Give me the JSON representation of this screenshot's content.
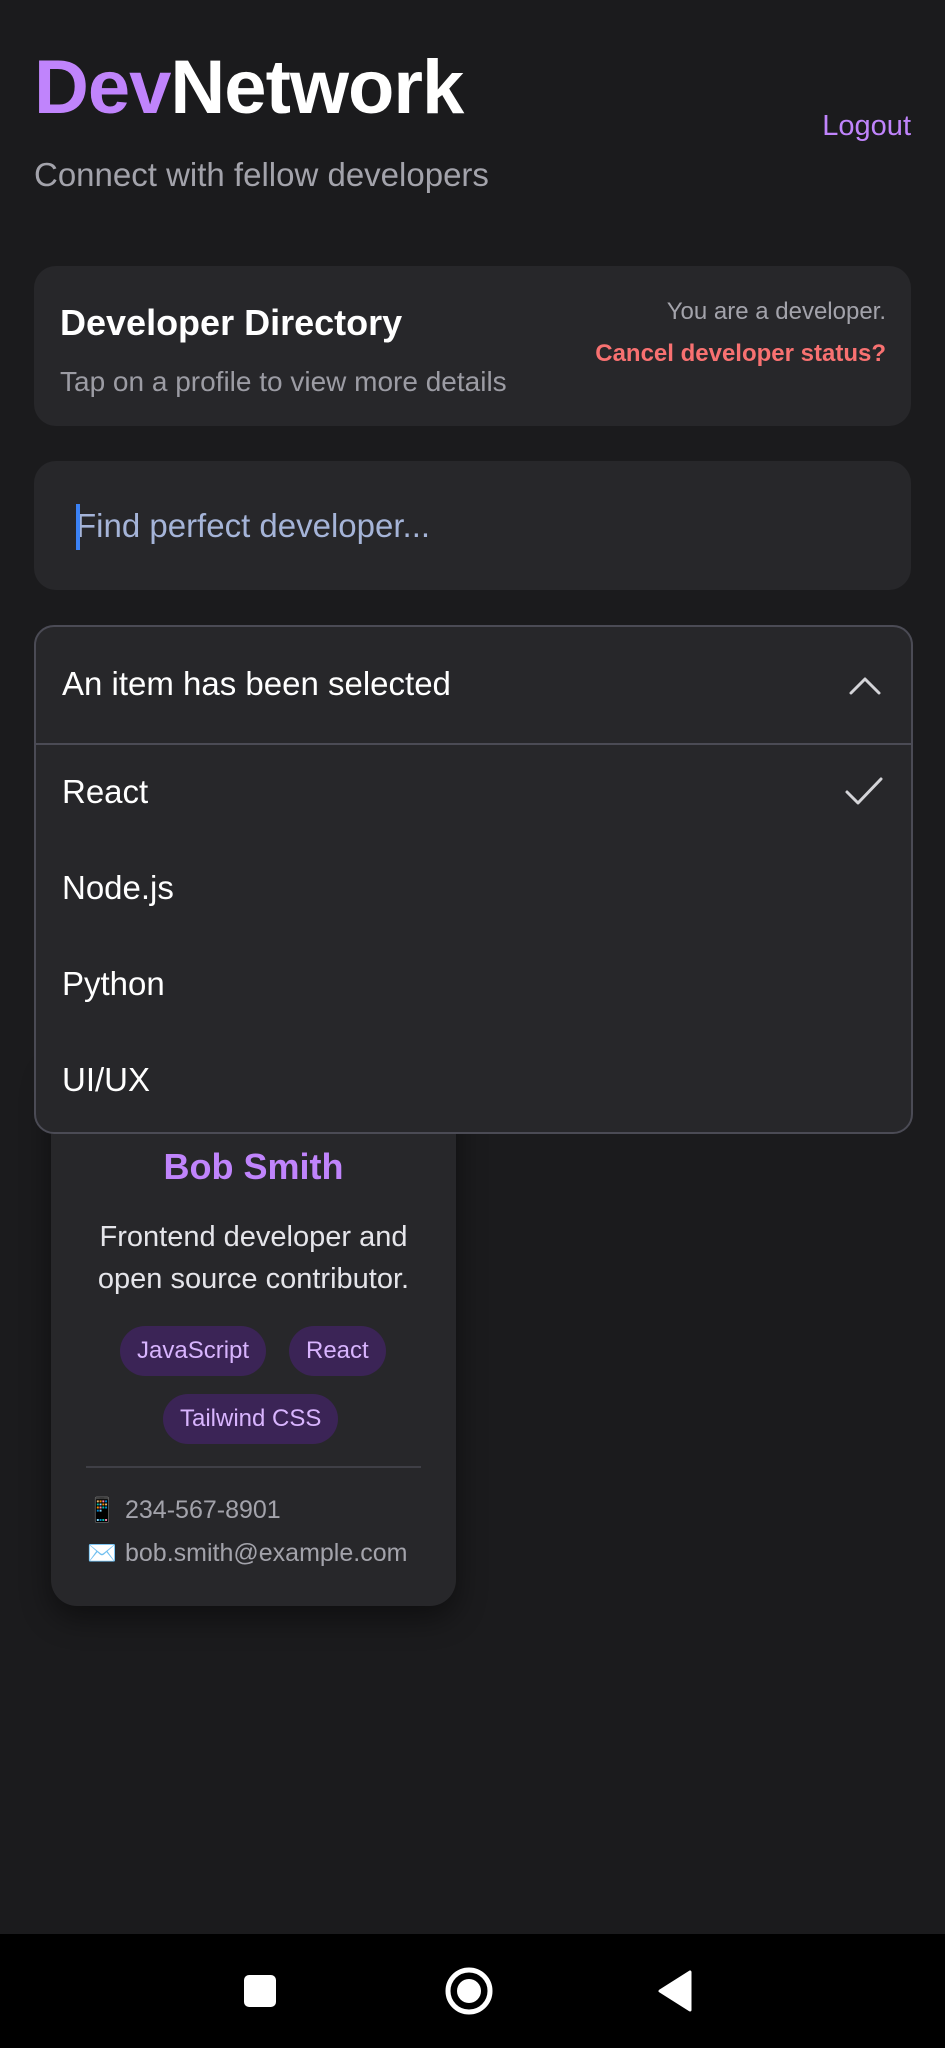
{
  "header": {
    "brand_part1": "Dev",
    "brand_part2": "Network",
    "tagline": "Connect with fellow developers",
    "logout_label": "Logout"
  },
  "directory": {
    "title": "Developer Directory",
    "subtitle": "Tap on a profile to view more details",
    "status_text": "You are a developer.",
    "cancel_label": "Cancel developer status?"
  },
  "search": {
    "placeholder": "Find perfect developer..."
  },
  "dropdown": {
    "selected_label": "An item has been selected",
    "items": [
      {
        "label": "React",
        "selected": true
      },
      {
        "label": "Node.js",
        "selected": false
      },
      {
        "label": "Python",
        "selected": false
      },
      {
        "label": "UI/UX",
        "selected": false
      }
    ]
  },
  "profile": {
    "name": "Bob Smith",
    "bio": "Frontend developer and open source contributor.",
    "tags": [
      "JavaScript",
      "React",
      "Tailwind CSS"
    ],
    "phone": "234-567-8901",
    "email": "bob.smith@example.com",
    "phone_icon": "📱",
    "email_icon": "✉️"
  },
  "colors": {
    "accent": "#c084fc",
    "danger": "#f87171",
    "background": "#1b1b1d",
    "card": "#27272a"
  },
  "navbar": {
    "icons": [
      "recents-square-icon",
      "home-circle-icon",
      "back-triangle-icon"
    ]
  }
}
